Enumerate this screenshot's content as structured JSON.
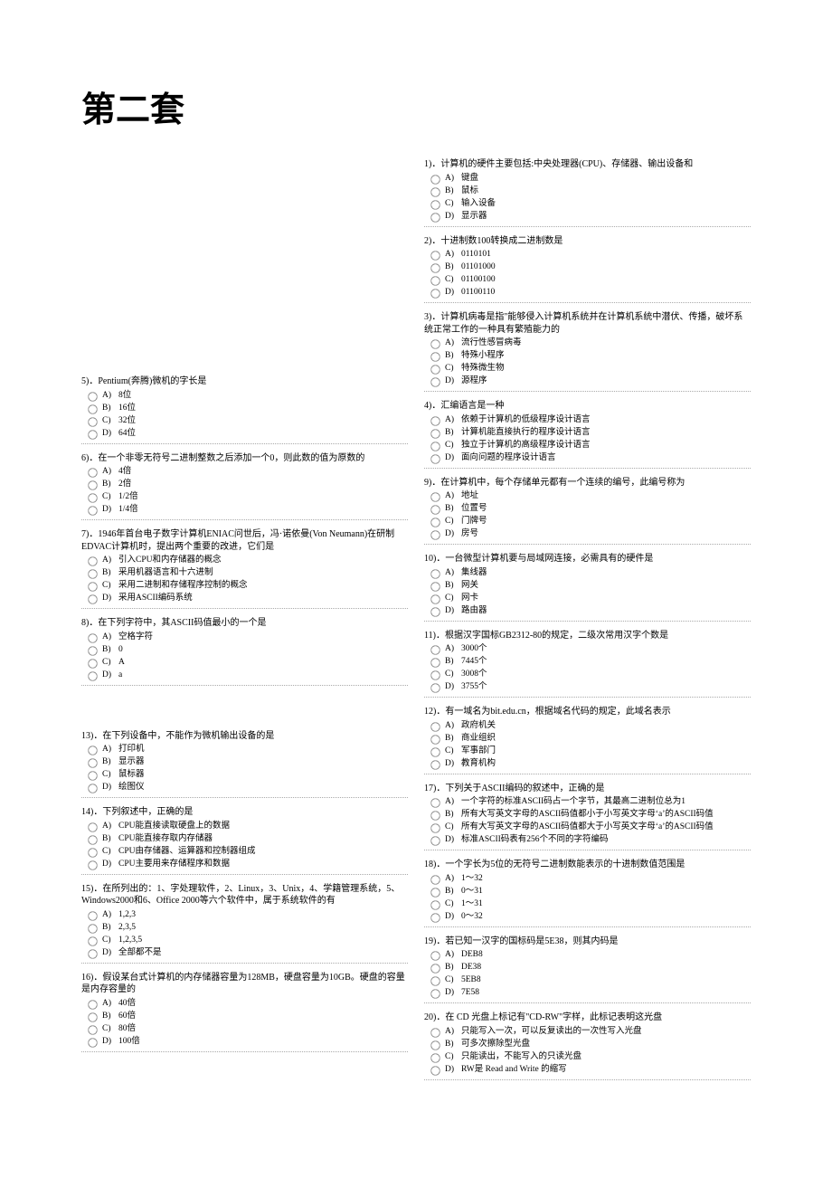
{
  "title": "第二套",
  "left": [
    {
      "n": "5",
      "text": "5)．Pentium(奔腾)微机的字长是",
      "opts": [
        "8位",
        "16位",
        "32位",
        "64位"
      ]
    },
    {
      "n": "6",
      "text": "6)．在一个非零无符号二进制整数之后添加一个0，则此数的值为原数的",
      "opts": [
        "4倍",
        "2倍",
        "1/2倍",
        "1/4倍"
      ]
    },
    {
      "n": "7",
      "text": "7)．1946年首台电子数字计算机ENIAC问世后，冯·诺依曼(Von Neumann)在研制EDVAC计算机时，提出两个重要的改进，它们是",
      "opts": [
        "引入CPU和内存储器的概念",
        "采用机器语言和十六进制",
        "采用二进制和存储程序控制的概念",
        "采用ASCII编码系统"
      ]
    },
    {
      "n": "8",
      "text": "8)．在下列字符中，其ASCII码值最小的一个是",
      "opts": [
        "空格字符",
        "0",
        "A",
        "a"
      ]
    },
    {
      "n": "13",
      "text": "13)．在下列设备中，不能作为微机输出设备的是",
      "gapBefore": true,
      "opts": [
        "打印机",
        "显示器",
        "鼠标器",
        "绘图仪"
      ]
    },
    {
      "n": "14",
      "text": "14)．下列叙述中，正确的是",
      "opts": [
        "CPU能直接读取硬盘上的数据",
        "CPU能直接存取内存储器",
        "CPU由存储器、运算器和控制器组成",
        "CPU主要用来存储程序和数据"
      ]
    },
    {
      "n": "15",
      "text": "15)．在所列出的：1、字处理软件，2、Linux，3、Unix，4、学籍管理系统，5、Windows2000和6、Office 2000等六个软件中，属于系统软件的有",
      "opts": [
        "1,2,3",
        "2,3,5",
        "1,2,3,5",
        "全部都不是"
      ]
    },
    {
      "n": "16",
      "text": "16)．假设某台式计算机的内存储器容量为128MB，硬盘容量为10GB。硬盘的容量是内存容量的",
      "opts": [
        "40倍",
        "60倍",
        "80倍",
        "100倍"
      ]
    }
  ],
  "right": [
    {
      "n": "1",
      "text": "1)．计算机的硬件主要包括:中央处理器(CPU)、存储器、输出设备和",
      "opts": [
        "键盘",
        "鼠标",
        "输入设备",
        "显示器"
      ]
    },
    {
      "n": "2",
      "text": "2)．十进制数100转换成二进制数是",
      "opts": [
        "0110101",
        "01101000",
        "01100100",
        "01100110"
      ]
    },
    {
      "n": "3",
      "text": "3)．计算机病毒是指\"能够侵入计算机系统并在计算机系统中潜伏、传播，破坏系统正常工作的一种具有繁殖能力的",
      "opts": [
        "流行性感冒病毒",
        "特殊小程序",
        "特殊微生物",
        "源程序"
      ]
    },
    {
      "n": "4",
      "text": "4)．汇编语言是一种",
      "opts": [
        "依赖于计算机的低级程序设计语言",
        "计算机能直接执行的程序设计语言",
        "独立于计算机的高级程序设计语言",
        "面向问题的程序设计语言"
      ]
    },
    {
      "n": "9",
      "text": "9)．在计算机中，每个存储单元都有一个连续的编号，此编号称为",
      "opts": [
        "地址",
        "位置号",
        "门牌号",
        "房号"
      ]
    },
    {
      "n": "10",
      "text": "10)．一台微型计算机要与局域网连接，必需具有的硬件是",
      "opts": [
        "集线器",
        "网关",
        "网卡",
        "路由器"
      ]
    },
    {
      "n": "11",
      "text": "11)．根据汉字国标GB2312-80的规定，二级次常用汉字个数是",
      "opts": [
        "3000个",
        "7445个",
        "3008个",
        "3755个"
      ]
    },
    {
      "n": "12",
      "text": "12)．有一域名为bit.edu.cn，根据域名代码的规定，此域名表示",
      "opts": [
        "政府机关",
        "商业组织",
        "军事部门",
        "教育机构"
      ]
    },
    {
      "n": "17",
      "text": "17)．下列关于ASCII编码的叙述中，正确的是",
      "opts": [
        "一个字符的标准ASCII码占一个字节，其最高二进制位总为1",
        "所有大写英文字母的ASCII码值都小于小写英文字母‘a’的ASCII码值",
        "所有大写英文字母的ASCII码值都大于小写英文字母‘a’的ASCII码值",
        "标准ASCII码表有256个不同的字符编码"
      ]
    },
    {
      "n": "18",
      "text": "18)．一个字长为5位的无符号二进制数能表示的十进制数值范围是",
      "opts": [
        "1～32",
        "0～31",
        "1～31",
        "0～32"
      ]
    },
    {
      "n": "19",
      "text": "19)．若已知一汉字的国标码是5E38，则其内码是",
      "opts": [
        "DEB8",
        "DE38",
        "5EB8",
        "7E58"
      ]
    },
    {
      "n": "20",
      "text": "20)．在 CD 光盘上标记有\"CD-RW\"字样，此标记表明这光盘",
      "opts": [
        "只能写入一次，可以反复读出的一次性写入光盘",
        "可多次擦除型光盘",
        "只能读出，不能写入的只读光盘",
        "RW是 Read and Write 的缩写"
      ]
    }
  ],
  "letters": [
    "A)",
    "B)",
    "C)",
    "D)"
  ]
}
